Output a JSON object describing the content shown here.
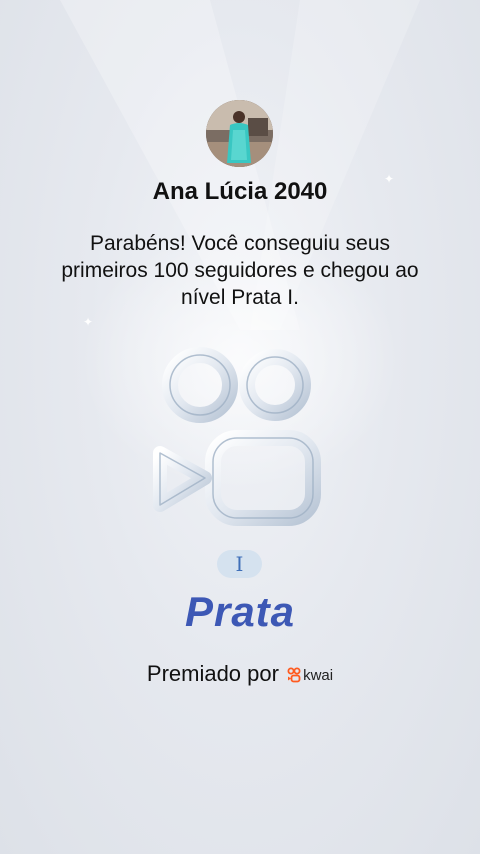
{
  "profile": {
    "name": "Ana Lúcia 2040"
  },
  "message": "Parabéns! Você conseguiu seus primeiros 100 seguidores e chegou ao nível Prata I.",
  "level": {
    "numeral": "I",
    "tier": "Prata"
  },
  "award": {
    "prefix": "Premiado por",
    "brand": "kwai"
  },
  "icons": [
    "kwai-logo-icon",
    "sparkle-icon"
  ],
  "colors": {
    "tier_text": "#3d58b5",
    "pill_bg": "#d5e2ef",
    "brand_orange": "#ff5a1f"
  }
}
